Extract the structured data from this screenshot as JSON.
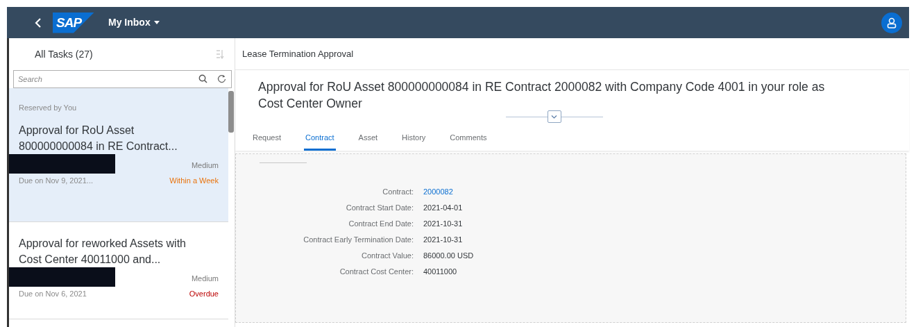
{
  "shell": {
    "logo": "SAP",
    "title": "My Inbox"
  },
  "task_list": {
    "title": "All Tasks (27)",
    "search": {
      "placeholder": "Search"
    },
    "tasks": [
      {
        "status_label": "Reserved by You",
        "title": "Approval for RoU Asset 800000000084 in RE Contract...",
        "redacted": true,
        "priority": "Medium",
        "due": "Due on Nov 9, 2021...",
        "deadline": "Within a Week",
        "color": "#e9730c",
        "selected": true
      },
      {
        "title": "Approval for reworked Assets with Cost Center 40011000 and...",
        "redacted": true,
        "priority": "Medium",
        "due": "Due on Nov 6, 2021",
        "deadline": "Overdue",
        "color": "#bb0000",
        "selected": false
      }
    ]
  },
  "detail": {
    "header": "Lease Termination Approval",
    "title": "Approval for RoU Asset 800000000084 in RE Contract 2000082 with Company Code 4001 in your role as Cost Center Owner",
    "tabs": [
      {
        "label": "Request",
        "selected": false
      },
      {
        "label": "Contract",
        "selected": true
      },
      {
        "label": "Asset",
        "selected": false
      },
      {
        "label": "History",
        "selected": false
      },
      {
        "label": "Comments",
        "selected": false
      }
    ],
    "fields": [
      {
        "label": "Contract:",
        "value": "2000082",
        "kind": "link"
      },
      {
        "label": "Contract Start Date:",
        "value": "2021-04-01",
        "kind": "text"
      },
      {
        "label": "Contract End Date:",
        "value": "2021-10-31",
        "kind": "text"
      },
      {
        "label": "Contract Early Termination Date:",
        "value": "2021-10-31",
        "kind": "text"
      },
      {
        "label": "Contract Value:",
        "value": "86000.00 USD",
        "kind": "text"
      },
      {
        "label": "Contract Cost Center:",
        "value": "40011000",
        "kind": "text"
      }
    ]
  }
}
